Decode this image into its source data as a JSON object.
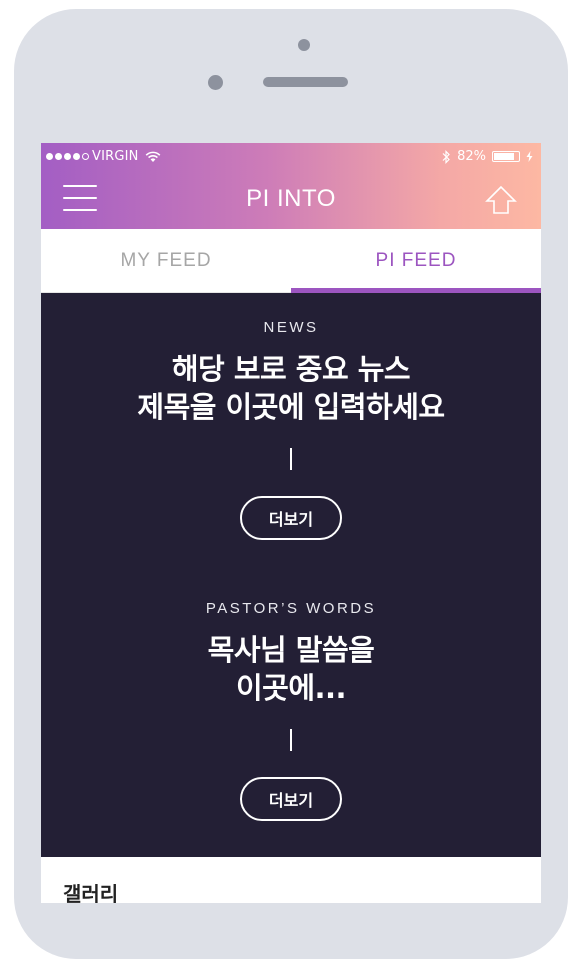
{
  "status_bar": {
    "carrier": "VIRGIN",
    "battery_percent": "82%",
    "battery_level": 0.82
  },
  "header": {
    "title": "PI INTO",
    "left_icon": "hamburger-menu-icon",
    "right_icon": "arrow-up-icon"
  },
  "tabs": [
    {
      "label": "MY FEED",
      "active": false
    },
    {
      "label": "PI FEED",
      "active": true
    }
  ],
  "feed": {
    "sections": [
      {
        "eyebrow": "NEWS",
        "headline_lines": [
          "해당 보로 중요 뉴스",
          "제목을 이곳에 입력하세요"
        ],
        "button_label": "더보기"
      },
      {
        "eyebrow": "PASTOR’S WORDS",
        "headline_lines": [
          "목사님 말씀을",
          "이곳에..."
        ],
        "button_label": "더보기"
      }
    ]
  },
  "next_section": {
    "label": "갤러리"
  },
  "colors": {
    "accent": "#9c55c0",
    "feed_background": "#231f35",
    "header_gradient_start": "#a35ec4",
    "header_gradient_end": "#fdb8a3"
  }
}
